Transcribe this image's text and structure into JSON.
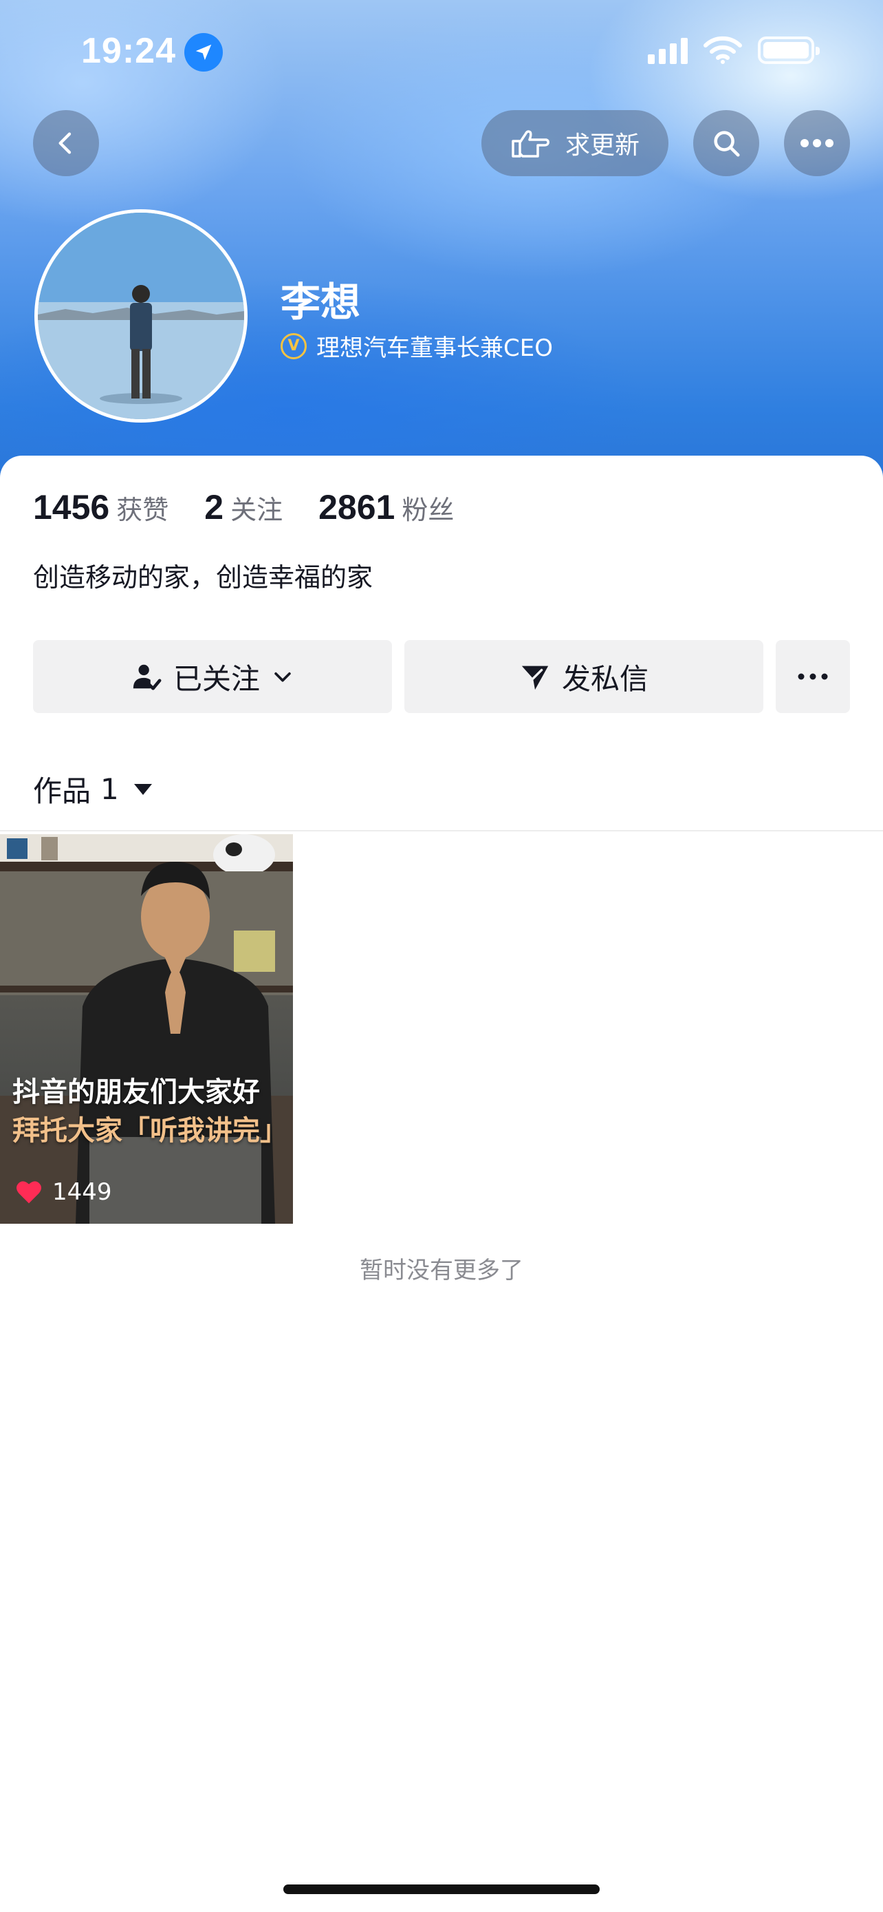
{
  "status_bar": {
    "time": "19:24"
  },
  "header": {
    "request_update_label": "求更新",
    "icons": {
      "back": "chevron-left-icon",
      "search": "search-icon",
      "more": "more-horizontal-icon",
      "request": "hand-point-icon"
    }
  },
  "profile": {
    "name": "李想",
    "verification": "理想汽车董事长兼CEO",
    "verified_badge": "V",
    "bio": "创造移动的家，创造幸福的家"
  },
  "stats": [
    {
      "value": "1456",
      "label": "获赞"
    },
    {
      "value": "2",
      "label": "关注"
    },
    {
      "value": "2861",
      "label": "粉丝"
    }
  ],
  "actions": {
    "follow_label": "已关注",
    "message_label": "发私信"
  },
  "tabs": {
    "works_label": "作品",
    "works_count": "1"
  },
  "videos": [
    {
      "caption_line1": "抖音的朋友们大家好",
      "caption_line2": "拜托大家「听我讲完」",
      "likes": "1449"
    }
  ],
  "footer": {
    "no_more": "暂时没有更多了"
  },
  "colors": {
    "accent_blue": "#2f7fe0",
    "badge_gold": "#f5c342",
    "like_red": "#fe2c55"
  }
}
